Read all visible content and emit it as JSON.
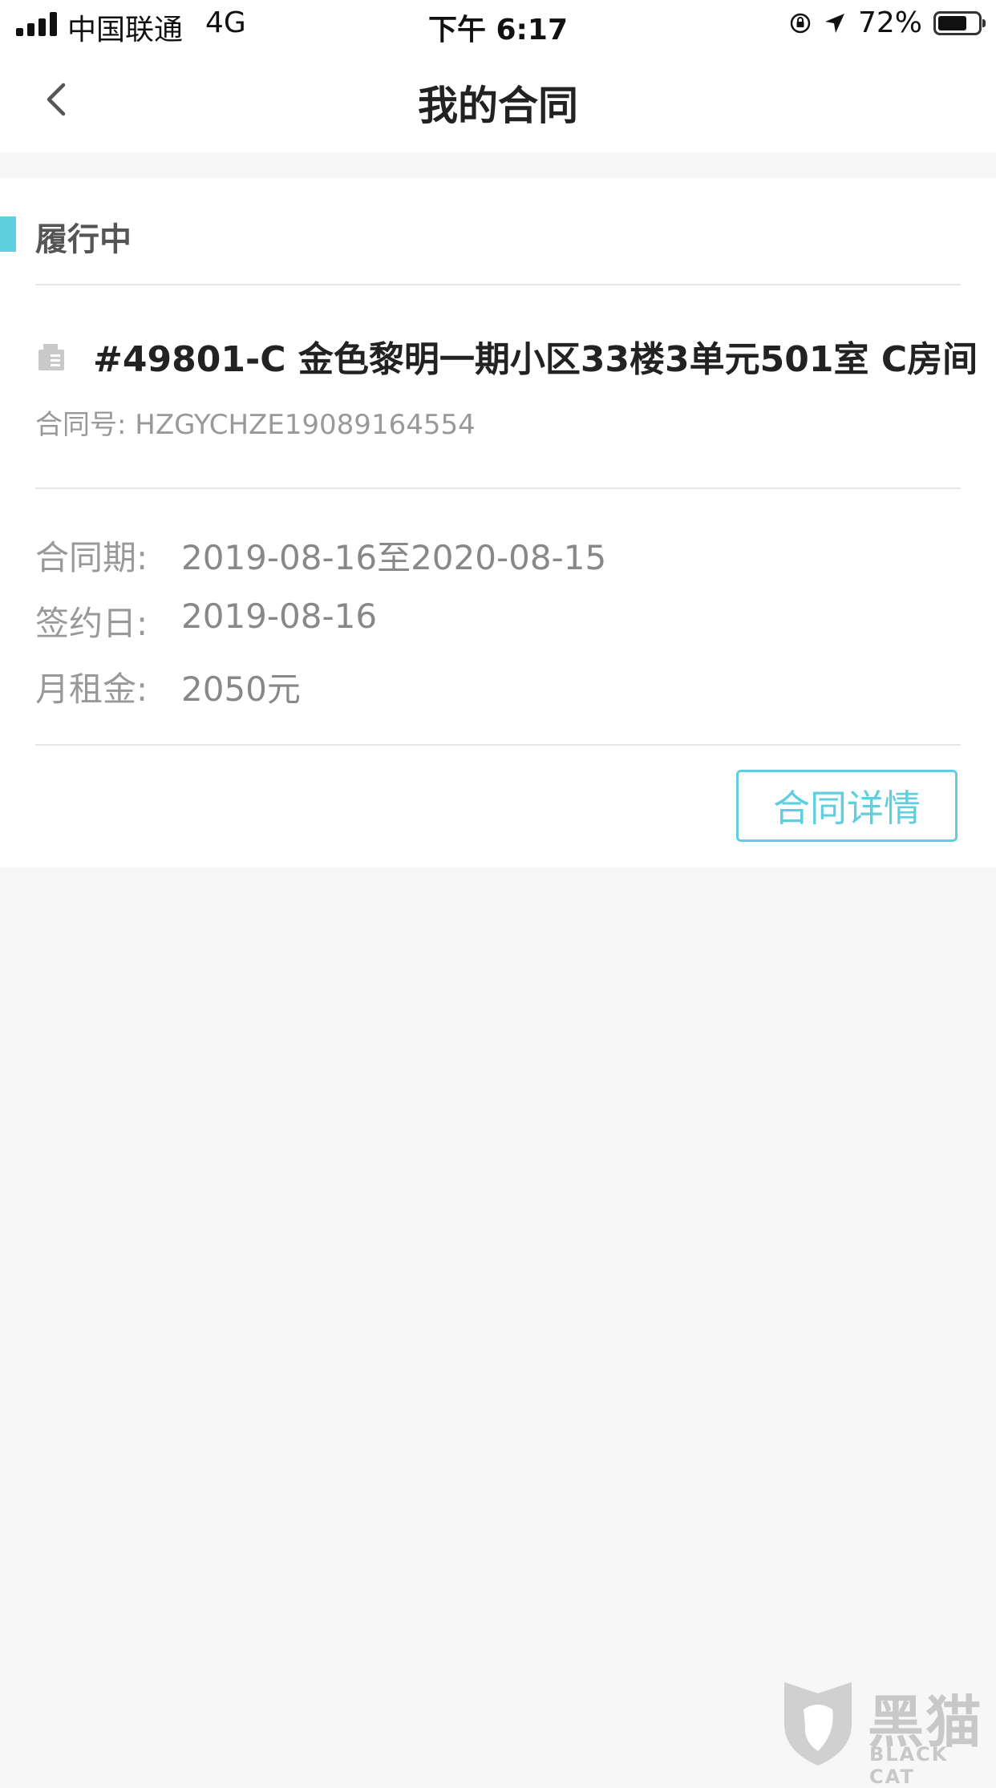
{
  "status_bar": {
    "carrier": "中国联通",
    "network": "4G",
    "time": "下午 6:17",
    "battery": "72%",
    "battery_level": 0.72
  },
  "nav": {
    "title": "我的合同"
  },
  "contract": {
    "status": "履行中",
    "room_title": "#49801-C 金色黎明一期小区33楼3单元501室 C房间",
    "contract_no_label": "合同号:",
    "contract_no": "HZGYCHZE19089164554",
    "period_label": "合同期:",
    "period_value": "2019-08-16至2020-08-15",
    "sign_label": "签约日:",
    "sign_value": "2019-08-16",
    "rent_label": "月租金:",
    "rent_value": "2050元",
    "detail_button": "合同详情"
  },
  "watermark": {
    "text": "黑猫",
    "sub": "BLACK CAT"
  },
  "colors": {
    "accent": "#5fcfe0"
  }
}
